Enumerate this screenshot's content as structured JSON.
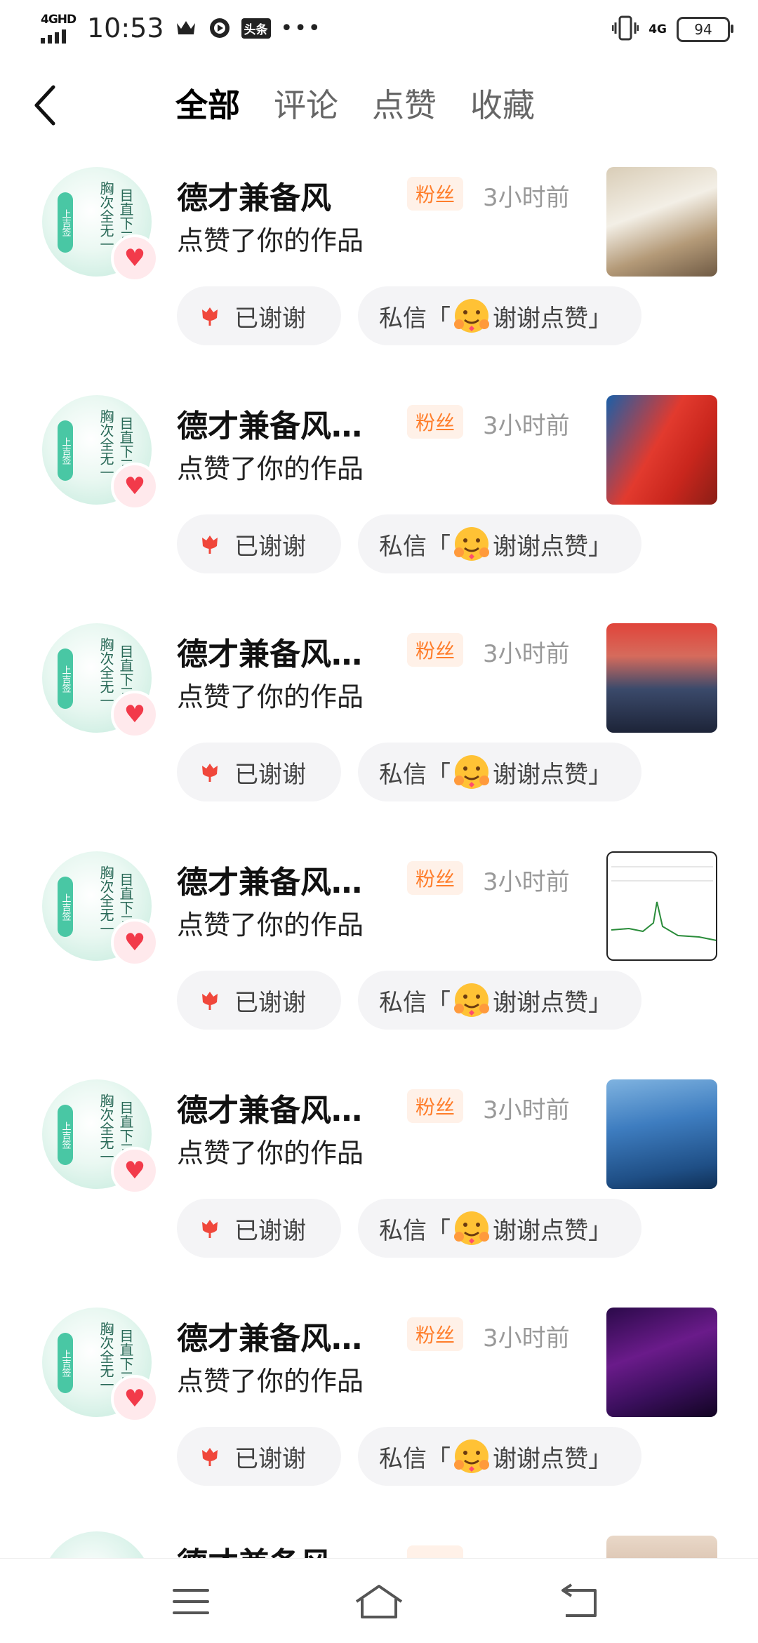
{
  "status": {
    "network": "4GHD",
    "time": "10:53",
    "more": "•••",
    "toutiao": "头条",
    "signal2": "4G",
    "battery": "94"
  },
  "header": {
    "tabs": [
      {
        "label": "全部",
        "active": true
      },
      {
        "label": "评论",
        "active": false
      },
      {
        "label": "点赞",
        "active": false
      },
      {
        "label": "收藏",
        "active": false
      }
    ]
  },
  "items": [
    {
      "name": "德才兼备风",
      "badge": "粉丝",
      "time": "3小时前",
      "action": "点赞了你的作品",
      "thanked": "已谢谢",
      "msg_prefix": "私信「",
      "msg_suffix": "谢谢点赞」",
      "thumb": "thumb-1"
    },
    {
      "name": "德才兼备风…",
      "badge": "粉丝",
      "time": "3小时前",
      "action": "点赞了你的作品",
      "thanked": "已谢谢",
      "msg_prefix": "私信「",
      "msg_suffix": "谢谢点赞」",
      "thumb": "thumb-2"
    },
    {
      "name": "德才兼备风…",
      "badge": "粉丝",
      "time": "3小时前",
      "action": "点赞了你的作品",
      "thanked": "已谢谢",
      "msg_prefix": "私信「",
      "msg_suffix": "谢谢点赞」",
      "thumb": "thumb-3"
    },
    {
      "name": "德才兼备风…",
      "badge": "粉丝",
      "time": "3小时前",
      "action": "点赞了你的作品",
      "thanked": "已谢谢",
      "msg_prefix": "私信「",
      "msg_suffix": "谢谢点赞」",
      "thumb": "thumb-4"
    },
    {
      "name": "德才兼备风…",
      "badge": "粉丝",
      "time": "3小时前",
      "action": "点赞了你的作品",
      "thanked": "已谢谢",
      "msg_prefix": "私信「",
      "msg_suffix": "谢谢点赞」",
      "thumb": "thumb-5"
    },
    {
      "name": "德才兼备风…",
      "badge": "粉丝",
      "time": "3小时前",
      "action": "点赞了你的作品",
      "thanked": "已谢谢",
      "msg_prefix": "私信「",
      "msg_suffix": "谢谢点赞」",
      "thumb": "thumb-6"
    }
  ],
  "partial_item": {
    "name": "德才兼备风"
  },
  "avatar_text": {
    "col1": "胸次全无一",
    "col2": "目直下三",
    "seal": "上吉签"
  },
  "colors": {
    "accent": "#f23a4a",
    "badge_text": "#ff7d2a",
    "badge_bg": "#fff1e8",
    "pill_bg": "#f4f4f6"
  }
}
